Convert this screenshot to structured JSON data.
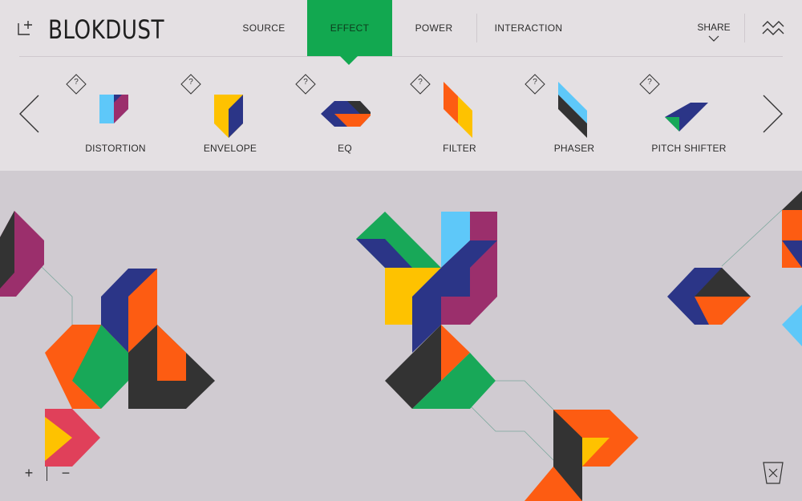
{
  "app": {
    "title": "BLOKDUST"
  },
  "nav": {
    "tabs": [
      {
        "label": "SOURCE"
      },
      {
        "label": "EFFECT",
        "active": true
      },
      {
        "label": "POWER"
      },
      {
        "label": "INTERACTION"
      }
    ],
    "share_label": "SHARE"
  },
  "tray": {
    "help_glyph": "?",
    "items": [
      {
        "label": "DISTORTION"
      },
      {
        "label": "ENVELOPE"
      },
      {
        "label": "EQ"
      },
      {
        "label": "FILTER"
      },
      {
        "label": "PHASER"
      },
      {
        "label": "PITCH SHIFTER"
      }
    ]
  },
  "zoom": {
    "in_label": "+",
    "out_label": "−"
  },
  "icons": [
    "new-block-icon",
    "chevron-down-icon",
    "waves-icon",
    "chevron-left-icon",
    "chevron-right-icon",
    "help-icon",
    "trash-icon"
  ],
  "colors": {
    "header_bg": "#e4e0e3",
    "canvas_bg": "#d0cbd1",
    "accent_green": "#12a850",
    "purple": "#9b2f6c",
    "navy": "#2b3587",
    "orange": "#fd5c12",
    "yellow": "#fec200",
    "sky": "#5ec8f9",
    "charcoal": "#333333",
    "pink": "#e0405a",
    "green": "#18a858"
  }
}
